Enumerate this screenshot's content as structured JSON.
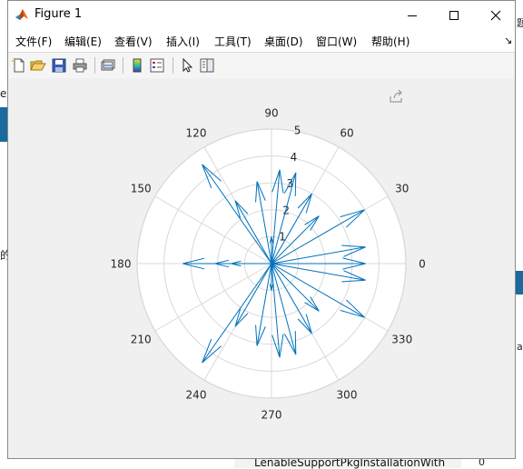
{
  "window": {
    "title": "Figure 1"
  },
  "menu": [
    "文件(F)",
    "编辑(E)",
    "查看(V)",
    "插入(I)",
    "工具(T)",
    "桌面(D)",
    "窗口(W)",
    "帮助(H)"
  ],
  "toolbar": {
    "icons": [
      "new-figure-icon",
      "open-file-icon",
      "save-icon",
      "print-icon",
      "link-icon",
      "colorbar-icon",
      "legend-icon",
      "pointer-icon",
      "property-editor-icon"
    ]
  },
  "colors": {
    "accent": "#0072bd",
    "grid": "#d9d9d9",
    "axes_bg": "#ffffff",
    "figure_bg": "#f0f0f0"
  },
  "background_app": {
    "left_text_1": "e",
    "left_text_2": "的",
    "right_text_1": "题",
    "right_text_2": "al",
    "bottom_text": "LenableSupportPkgInstallationWith",
    "bottom_right": "0"
  },
  "chart_data": {
    "type": "compass",
    "angle_ticks": [
      "0",
      "30",
      "60",
      "90",
      "120",
      "150",
      "180",
      "210",
      "240",
      "270",
      "300",
      "330"
    ],
    "radial_ticks": [
      "1",
      "2",
      "3",
      "4",
      "5"
    ],
    "rlim": [
      0,
      5
    ],
    "series": [
      {
        "arrows": [
          {
            "theta": 0,
            "r": 3.5
          },
          {
            "theta": 10,
            "r": 3.55
          },
          {
            "theta": -10,
            "r": 3.55
          },
          {
            "theta": 30,
            "r": 4.0
          },
          {
            "theta": -30,
            "r": 4.0
          },
          {
            "theta": 45,
            "r": 2.5
          },
          {
            "theta": -45,
            "r": 2.5
          },
          {
            "theta": 60,
            "r": 3.0
          },
          {
            "theta": -60,
            "r": 3.0
          },
          {
            "theta": 75,
            "r": 3.5
          },
          {
            "theta": -75,
            "r": 3.5
          },
          {
            "theta": 85,
            "r": 3.5
          },
          {
            "theta": -85,
            "r": 3.5
          },
          {
            "theta": 90,
            "r": 1.0
          },
          {
            "theta": -90,
            "r": 1.0
          },
          {
            "theta": 100,
            "r": 3.1
          },
          {
            "theta": -100,
            "r": 3.1
          },
          {
            "theta": 120,
            "r": 2.7
          },
          {
            "theta": -120,
            "r": 2.7
          },
          {
            "theta": 125,
            "r": 4.5
          },
          {
            "theta": -125,
            "r": 4.5
          },
          {
            "theta": 180,
            "r": 3.3
          },
          {
            "theta": 180,
            "r": 2.1
          },
          {
            "theta": 180,
            "r": 1.5
          }
        ]
      }
    ]
  }
}
